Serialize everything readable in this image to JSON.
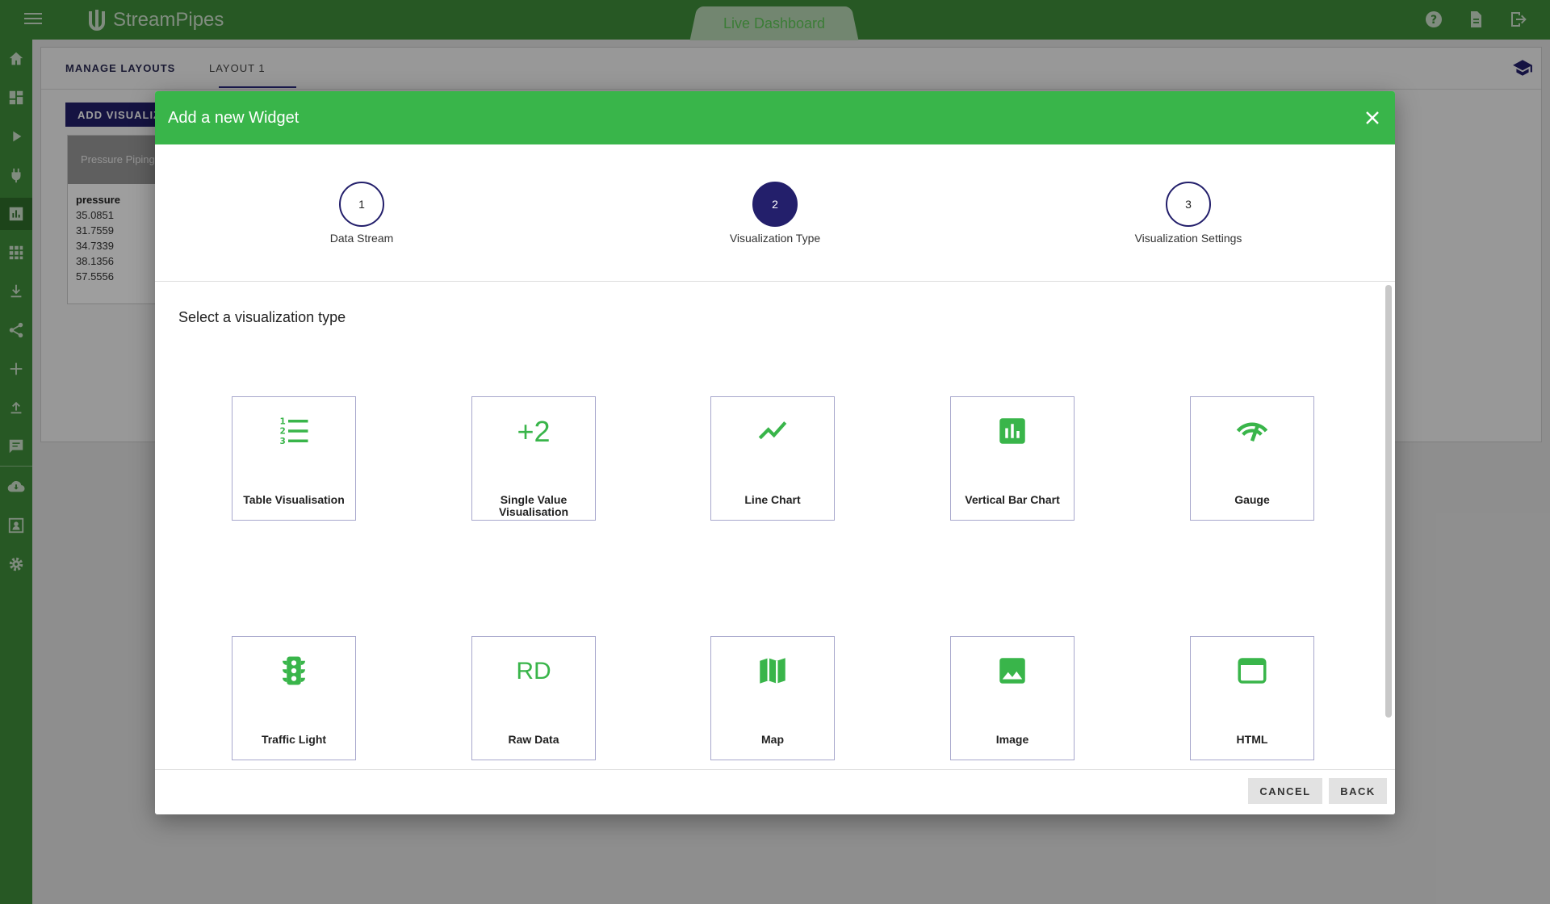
{
  "app": {
    "name": "StreamPipes",
    "active_view": "Live Dashboard"
  },
  "background": {
    "tabs": {
      "manage": "MANAGE LAYOUTS",
      "layout": "LAYOUT 1"
    },
    "add_button": "ADD VISUALIZATION",
    "widget": {
      "title": "Pressure Piping",
      "field": "pressure",
      "values": [
        "35.0851",
        "31.7559",
        "34.7339",
        "38.1356",
        "57.5556"
      ]
    }
  },
  "modal": {
    "title": "Add a new Widget",
    "steps": [
      {
        "number": "1",
        "label": "Data Stream"
      },
      {
        "number": "2",
        "label": "Visualization Type"
      },
      {
        "number": "3",
        "label": "Visualization Settings"
      }
    ],
    "active_step": 2,
    "prompt": "Select a visualization type",
    "tiles": [
      {
        "label": "Table Visualisation",
        "icon": "format-list-numbered-icon"
      },
      {
        "label": "Single Value Visualisation",
        "icon_text": "+2"
      },
      {
        "label": "Line Chart",
        "icon": "show-chart-icon"
      },
      {
        "label": "Vertical Bar Chart",
        "icon": "insert-chart-icon"
      },
      {
        "label": "Gauge",
        "icon": "gauge-icon"
      },
      {
        "label": "Traffic Light",
        "icon": "traffic-icon"
      },
      {
        "label": "Raw Data",
        "icon_text": "RD"
      },
      {
        "label": "Map",
        "icon": "map-icon"
      },
      {
        "label": "Image",
        "icon": "image-icon"
      },
      {
        "label": "HTML",
        "icon": "web-asset-icon"
      }
    ],
    "footer": {
      "cancel": "CANCEL",
      "back": "BACK"
    }
  },
  "colors": {
    "brand_green": "#39b54a",
    "nav_green": "#3f8f3a",
    "primary_navy": "#231f6b"
  }
}
